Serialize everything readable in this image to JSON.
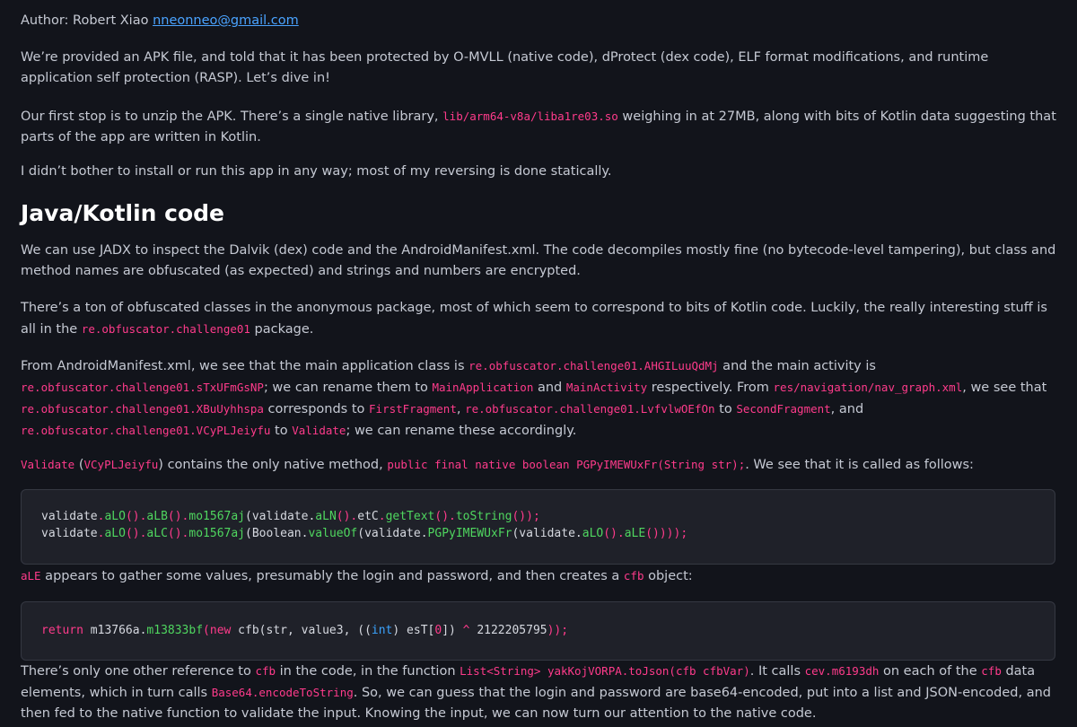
{
  "author": {
    "label": "Author: Robert Xiao ",
    "email": "nneonneo@gmail.com"
  },
  "intro": {
    "p2": "We’re provided an APK file, and told that it has been protected by O-MVLL (native code), dProtect (dex code), ELF format modifications, and runtime application self protection (RASP). Let’s dive in!",
    "p3_a": "Our first stop is to unzip the APK. There’s a single native library, ",
    "p3_code": "lib/arm64-v8a/liba1re03.so",
    "p3_b": " weighing in at 27MB, along with bits of Kotlin data suggesting that parts of the app are written in Kotlin.",
    "p4": "I didn’t bother to install or run this app in any way; most of my reversing is done statically."
  },
  "section": {
    "heading": "Java/Kotlin code",
    "p5": "We can use JADX to inspect the Dalvik (dex) code and the AndroidManifest.xml. The code decompiles mostly fine (no bytecode-level tampering), but class and method names are obfuscated (as expected) and strings and numbers are encrypted.",
    "p6_a": "There’s a ton of obfuscated classes in the anonymous package, most of which seem to correspond to bits of Kotlin code. Luckily, the really interesting stuff is all in the ",
    "p6_code": "re.obfuscator.challenge01",
    "p6_b": " package.",
    "p7_a": "From AndroidManifest.xml, we see that the main application class is ",
    "p7_c1": "re.obfuscator.challenge01.AHGILuuQdMj",
    "p7_b": " and the main activity is ",
    "p7_c2": "re.obfuscator.challenge01.sTxUFmGsNP",
    "p7_c": "; we can rename them to ",
    "p7_c3": "MainApplication",
    "p7_d": " and ",
    "p7_c4": "MainActivity",
    "p7_e": " respectively. From ",
    "p7_c5": "res/navigation/nav_graph.xml",
    "p7_f": ", we see that ",
    "p7_c6": "re.obfuscator.challenge01.XBuUyhhspa",
    "p7_g": " corresponds to ",
    "p7_c7": "FirstFragment",
    "p7_h": ", ",
    "p7_c8": "re.obfuscator.challenge01.LvfvlwOEfOn",
    "p7_i": " to ",
    "p7_c9": "SecondFragment",
    "p7_j": ", and ",
    "p7_c10": "re.obfuscator.challenge01.VCyPLJeiyfu",
    "p7_k": " to ",
    "p7_c11": "Validate",
    "p7_l": "; we can rename these accordingly.",
    "p8_c1": "Validate",
    "p8_a": " (",
    "p8_c2": "VCyPLJeiyfu",
    "p8_b": ") contains the only native method, ",
    "p8_c3": "public final native boolean PGPyIMEWUxFr(String str);",
    "p8_c": ". We see that it is called as follows:",
    "p9_c1": "aLE",
    "p9_a": " appears to gather some values, presumably the login and password, and then creates a ",
    "p9_c2": "cfb",
    "p9_b": " object:",
    "p10_a": "There’s only one other reference to ",
    "p10_c1": "cfb",
    "p10_b": " in the code, in the function ",
    "p10_c2": "List<String> yakKojVORPA.toJson(cfb cfbVar)",
    "p10_c": ". It calls ",
    "p10_c3": "cev.m6193dh",
    "p10_d": " on each of the ",
    "p10_c4": "cfb",
    "p10_e": " data elements, which in turn calls ",
    "p10_c5": "Base64.encodeToString",
    "p10_f": ". So, we can guess that the login and password are base64-encoded, put into a list and JSON-encoded, and then fed to the native function to validate the input. Knowing the input, we can now turn our attention to the native code."
  },
  "code1": {
    "l1": {
      "t1": "validate",
      "t2": ".",
      "t3": "aLO",
      "t4": "().",
      "t5": "aLB",
      "t6": "().",
      "t7": "mo1567aj",
      "t8": "(validate.",
      "t9": "aLN",
      "t10": "().",
      "t11": "etC",
      "t12": ".",
      "t13": "getText",
      "t14": "().",
      "t15": "toString",
      "t16": "());"
    },
    "l2": {
      "t1": "validate",
      "t2": ".",
      "t3": "aLO",
      "t4": "().",
      "t5": "aLC",
      "t6": "().",
      "t7": "mo1567aj",
      "t8": "(Boolean.",
      "t9": "valueOf",
      "t10": "(validate.",
      "t11": "PGPyIMEWUxFr",
      "t12": "(validate.",
      "t13": "aLO",
      "t14": "().",
      "t15": "aLE",
      "t16": "())));"
    }
  },
  "code2": {
    "t1": "return",
    "t2": " m13766a.",
    "t3": "m13833bf",
    "t4": "(",
    "t5": "new",
    "t6": " cfb(str, value3, ((",
    "t7": "int",
    "t8": ") esT[",
    "t9": "0",
    "t10": "]) ",
    "t11": "^",
    "t12": " 2122205795",
    "t13": "));"
  },
  "colors": {
    "background": "#12141b",
    "text": "#c5c9d3",
    "heading": "#ffffff",
    "code_inline": "#ff3b8b",
    "link": "#4aa3ff",
    "code_fn": "#4fd65f",
    "code_type": "#3ba4ff",
    "code_bg": "#1f2129"
  }
}
